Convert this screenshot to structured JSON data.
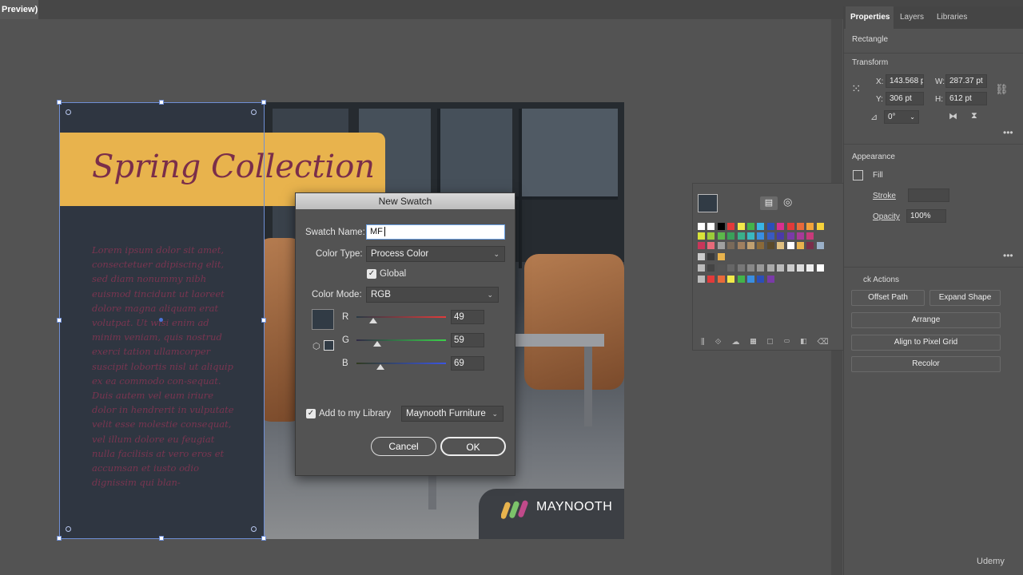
{
  "window": {
    "doc_tab": "Preview)"
  },
  "artboard": {
    "banner_title": "Spring Collection",
    "body_text": "Lorem ipsum dolor sit amet, consectetuer adipiscing elit, sed diam nonummy nibh euismod tincidunt ut laoreet dolore magna aliquam erat volutpat. Ut wisi enim ad minim veniam, quis nostrud exerci tation ullamcorper suscipit lobortis nisl ut aliquip ex ea commodo con-sequat. Duis autem vel eum iriure dolor in hendrerit in vulputate velit esse molestie consequat, vel illum dolore eu feugiat nulla facilisis at vero eros et accumsan et iusto odio dignissim qui blan-",
    "logo_text": "MAYNOOTH",
    "colors": {
      "panel": "#2f3641",
      "banner": "#e8b34d",
      "title": "#7a2e4a"
    }
  },
  "dialog": {
    "title": "New Swatch",
    "swatch_name_label": "Swatch Name:",
    "swatch_name_value": "MF",
    "color_type_label": "Color Type:",
    "color_type_value": "Process Color",
    "global_label": "Global",
    "global_checked": true,
    "color_mode_label": "Color Mode:",
    "color_mode_value": "RGB",
    "channels": [
      {
        "label": "R",
        "value": "49",
        "fraction": 0.19
      },
      {
        "label": "G",
        "value": "59",
        "fraction": 0.23
      },
      {
        "label": "B",
        "value": "69",
        "fraction": 0.27
      }
    ],
    "preview_color": "#313b45",
    "add_library_label": "Add to my Library",
    "library_value": "Maynooth Furniture",
    "cancel_label": "Cancel",
    "ok_label": "OK"
  },
  "properties": {
    "tabs": [
      "Properties",
      "Layers",
      "Libraries"
    ],
    "object_type": "Rectangle",
    "transform_title": "Transform",
    "x_label": "X:",
    "x_value": "143.568 p",
    "y_label": "Y:",
    "y_value": "306 pt",
    "w_label": "W:",
    "w_value": "287.37 pt",
    "h_label": "H:",
    "h_value": "612 pt",
    "angle_value": "0°",
    "appearance_title": "Appearance",
    "fill_label": "Fill",
    "stroke_label": "Stroke",
    "opacity_label": "Opacity",
    "opacity_value": "100%",
    "quick_actions_title": "ck Actions",
    "offset_path": "Offset Path",
    "expand_shape": "Expand Shape",
    "arrange": "Arrange",
    "align_pixel": "Align to Pixel Grid",
    "recolor": "Recolor"
  },
  "watermark": "Udemy"
}
